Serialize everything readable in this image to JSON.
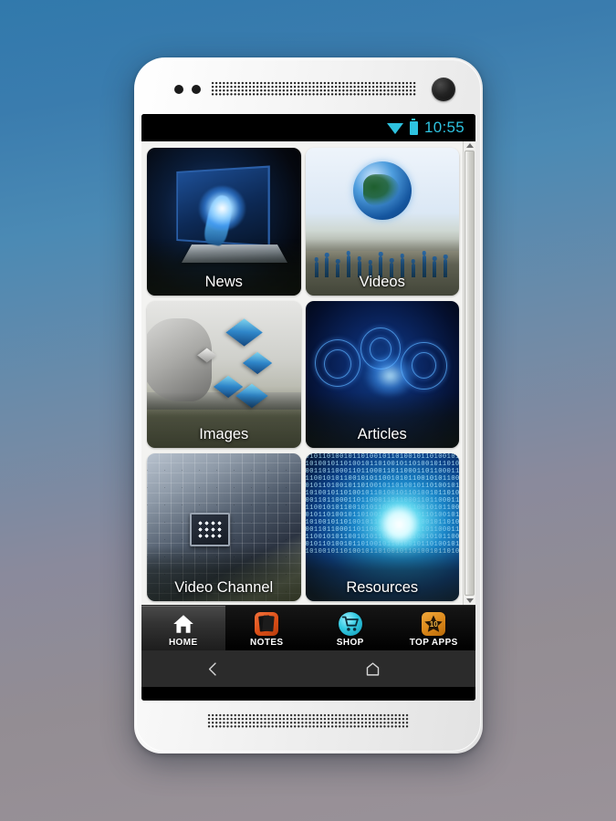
{
  "device": {
    "name": "android-phone-mockup",
    "sensor_dots": 2,
    "earpiece": "speaker-grille",
    "front_camera": "camera-lens"
  },
  "statusbar": {
    "wifi": "wifi-icon",
    "battery": "battery-icon",
    "time": "10:55",
    "accent_color": "#2ec3e0",
    "background_color": "#000000"
  },
  "app": {
    "background_color": "#f3f3f1",
    "grid": {
      "columns": 2,
      "rows": 3,
      "tiles": [
        {
          "label": "News",
          "art": "hand-reaching-from-laptop-screen"
        },
        {
          "label": "Videos",
          "art": "blue-globe-with-people-silhouettes"
        },
        {
          "label": "Images",
          "art": "hands-on-desk-with-floating-cubes"
        },
        {
          "label": "Articles",
          "art": "glowing-blue-network-world-map"
        },
        {
          "label": "Video Channel",
          "art": "circuit-board-with-microchip"
        },
        {
          "label": "Resources",
          "art": "binary-code-tunnel"
        }
      ]
    },
    "scrollbar": {
      "up_arrow": "scroll-up-arrow",
      "down_arrow": "scroll-down-arrow",
      "thumb": "scroll-thumb"
    }
  },
  "tabbar": {
    "background_color": "#0a0a0a",
    "items": [
      {
        "label": "HOME",
        "icon": "home-icon",
        "selected": true,
        "icon_color": "#ffffff"
      },
      {
        "label": "NOTES",
        "icon": "notes-icon",
        "selected": false,
        "icon_color": "#dc4f17"
      },
      {
        "label": "SHOP",
        "icon": "shop-cart-icon",
        "selected": false,
        "icon_color": "#35cbe2"
      },
      {
        "label": "TOP APPS",
        "icon": "star-icon",
        "selected": false,
        "icon_color": "#dd8a1c",
        "badge": "10"
      }
    ]
  },
  "navbar": {
    "background_color": "#2b2b2b",
    "back": "back-chevron-icon",
    "home": "home-pentagon-icon"
  }
}
